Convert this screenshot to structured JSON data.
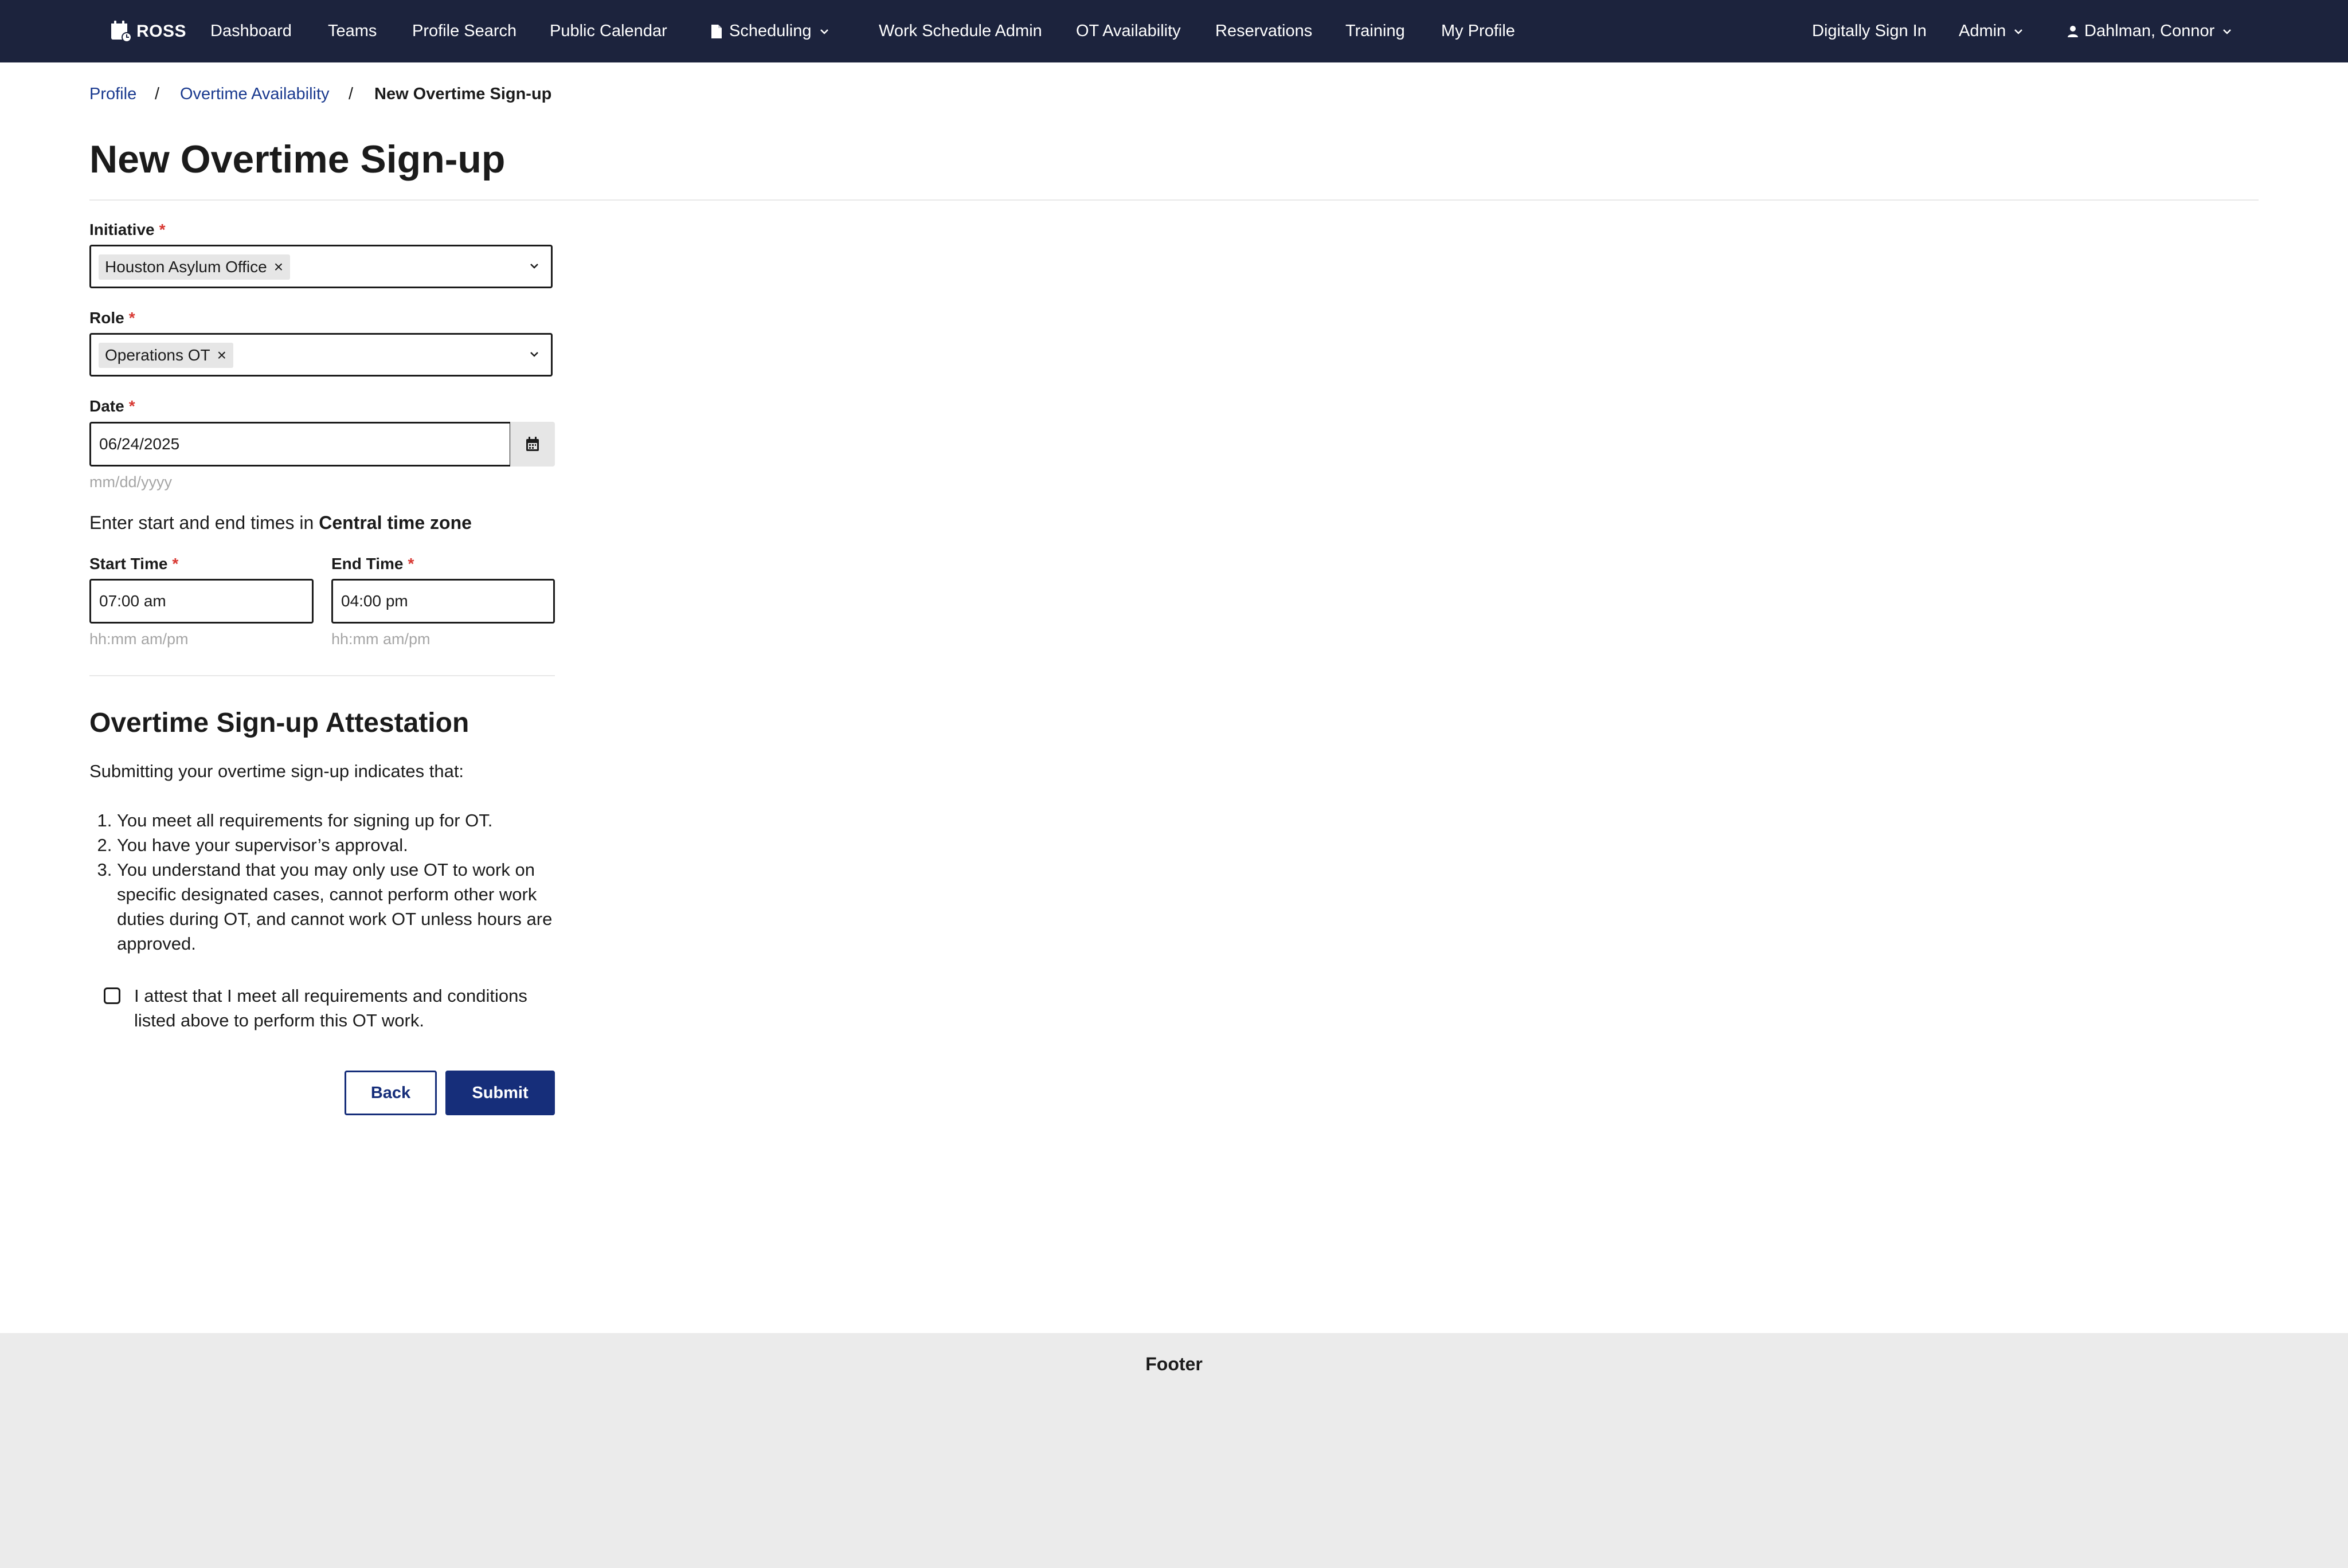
{
  "app": {
    "brand": "ROSS"
  },
  "nav": {
    "dashboard": "Dashboard",
    "teams": "Teams",
    "profile_search": "Profile Search",
    "public_calendar": "Public Calendar",
    "scheduling": "Scheduling",
    "work_schedule_admin": "Work Schedule Admin",
    "ot_availability": "OT Availability",
    "reservations": "Reservations",
    "training": "Training",
    "my_profile": "My Profile",
    "digitally_sign_in": "Digitally Sign In",
    "admin": "Admin",
    "user": "Dahlman, Connor"
  },
  "breadcrumb": {
    "items": [
      "Profile",
      "Overtime Availability",
      "New Overtime Sign-up"
    ],
    "separator": "/"
  },
  "page": {
    "title": "New Overtime Sign-up"
  },
  "form": {
    "initiative": {
      "label": "Initiative",
      "required": "*",
      "selected": "Houston Asylum Office",
      "remove": "×"
    },
    "role": {
      "label": "Role",
      "required": "*",
      "selected": "Operations OT",
      "remove": "×"
    },
    "date": {
      "label": "Date",
      "required": "*",
      "value": "06/24/2025",
      "hint": "mm/dd/yyyy"
    },
    "timezone": {
      "prefix": "Enter start and end times in",
      "zone": "Central time zone"
    },
    "start_time": {
      "label": "Start Time",
      "required": "*",
      "value": "07:00 am",
      "hint": "hh:mm am/pm"
    },
    "end_time": {
      "label": "End Time",
      "required": "*",
      "value": "04:00 pm",
      "hint": "hh:mm am/pm"
    }
  },
  "attestation": {
    "title": "Overtime Sign-up Attestation",
    "intro": "Submitting your overtime sign-up indicates that:",
    "items": [
      "You meet all requirements for signing up for OT.",
      "You have your supervisor’s approval.",
      "You understand that you may only use OT to work on specific designated cases, cannot perform other work duties during OT, and cannot work OT unless hours are approved."
    ],
    "checkbox_label": "I attest that I meet all requirements and conditions listed above to perform this OT work.",
    "checked": false
  },
  "actions": {
    "back": "Back",
    "submit": "Submit"
  },
  "footer": {
    "text": "Footer"
  },
  "colors": {
    "nav_bg": "#1c233d",
    "link": "#1a3a8f",
    "primary": "#162e7a",
    "required": "#d83933",
    "footer_bg": "#ebebeb"
  },
  "icons": {
    "brand": "calendar-clock-icon",
    "scheduling": "document-icon",
    "user": "person-icon",
    "dropdown": "chevron-down-icon",
    "calendar": "calendar-icon"
  }
}
